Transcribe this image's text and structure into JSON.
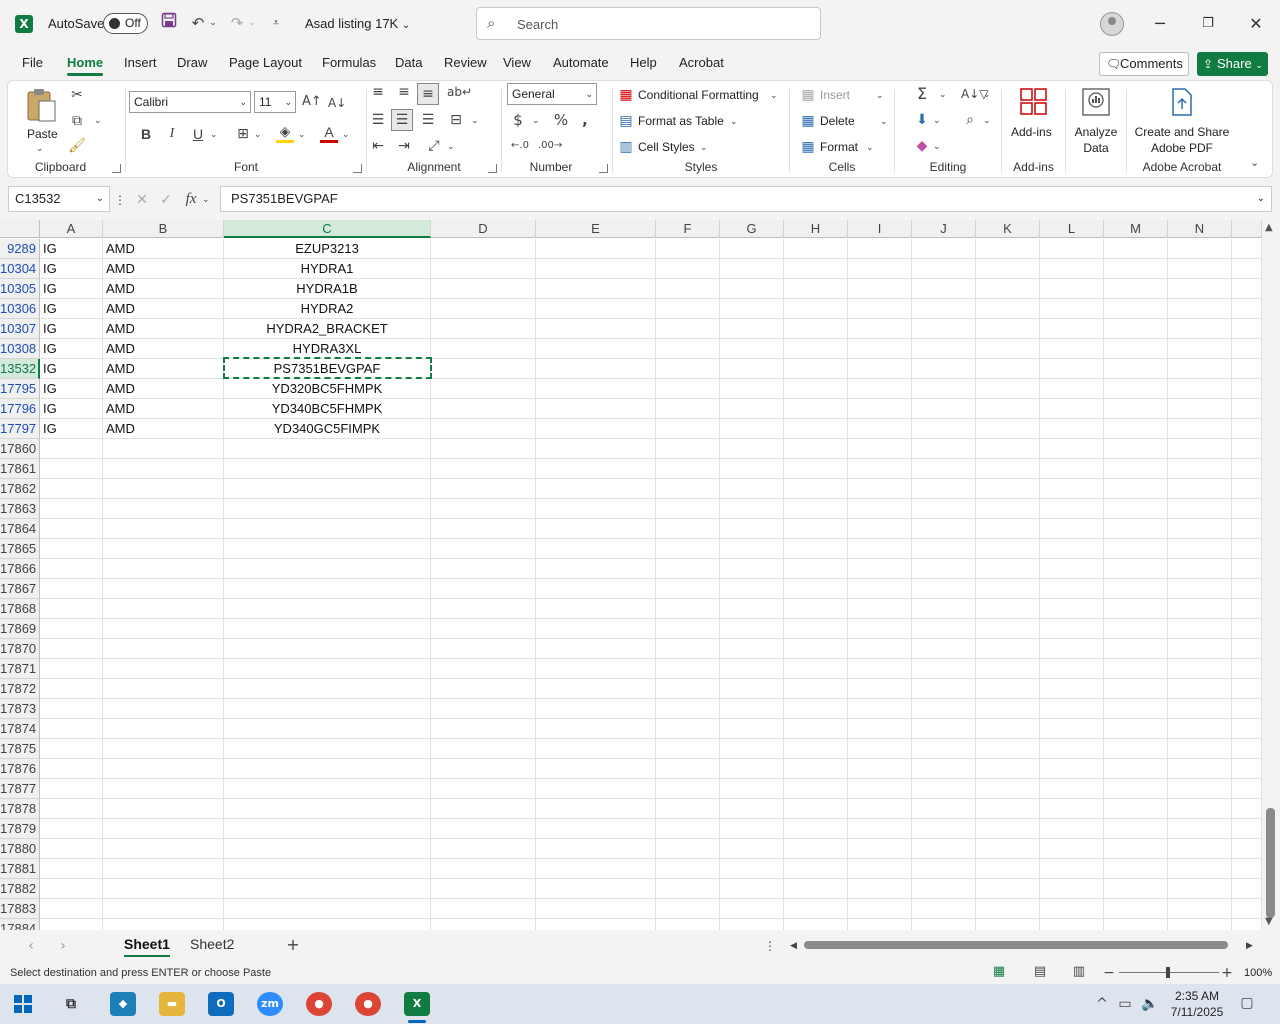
{
  "titlebar": {
    "autosave_label": "AutoSave",
    "autosave_state": "Off",
    "doc_title": "Asad listing 17K",
    "search_placeholder": "Search"
  },
  "menu": {
    "tabs": [
      "File",
      "Home",
      "Insert",
      "Draw",
      "Page Layout",
      "Formulas",
      "Data",
      "Review",
      "View",
      "Automate",
      "Help",
      "Acrobat"
    ],
    "active": "Home",
    "comments_label": "Comments",
    "share_label": "Share"
  },
  "ribbon": {
    "clipboard": {
      "paste_label": "Paste",
      "group_label": "Clipboard"
    },
    "font": {
      "font_name": "Calibri",
      "font_size": "11",
      "group_label": "Font",
      "bold": "B",
      "italic": "I",
      "underline": "U"
    },
    "alignment": {
      "group_label": "Alignment"
    },
    "number": {
      "format": "General",
      "group_label": "Number"
    },
    "styles": {
      "conditional": "Conditional Formatting",
      "format_table": "Format as Table",
      "cell_styles": "Cell Styles",
      "group_label": "Styles"
    },
    "cells": {
      "insert": "Insert",
      "delete": "Delete",
      "format": "Format",
      "group_label": "Cells"
    },
    "editing": {
      "group_label": "Editing"
    },
    "addins": {
      "label": "Add-ins",
      "group_label": "Add-ins"
    },
    "analyze": {
      "label_line1": "Analyze",
      "label_line2": "Data"
    },
    "acrobat": {
      "label_line1": "Create and Share",
      "label_line2": "Adobe PDF",
      "group_label": "Adobe Acrobat"
    }
  },
  "formula_bar": {
    "name_box": "C13532",
    "formula": "PS7351BEVGPAF"
  },
  "grid": {
    "columns": [
      "A",
      "B",
      "C",
      "D",
      "E",
      "F",
      "G",
      "H",
      "I",
      "J",
      "K",
      "L",
      "M",
      "N"
    ],
    "selected_column": "C",
    "data_rows": [
      {
        "row": "9289",
        "a": "IG",
        "b": "AMD",
        "c": "EZUP3213"
      },
      {
        "row": "10304",
        "a": "IG",
        "b": "AMD",
        "c": "HYDRA1"
      },
      {
        "row": "10305",
        "a": "IG",
        "b": "AMD",
        "c": "HYDRA1B"
      },
      {
        "row": "10306",
        "a": "IG",
        "b": "AMD",
        "c": "HYDRA2"
      },
      {
        "row": "10307",
        "a": "IG",
        "b": "AMD",
        "c": "HYDRA2_BRACKET"
      },
      {
        "row": "10308",
        "a": "IG",
        "b": "AMD",
        "c": "HYDRA3XL"
      },
      {
        "row": "13532",
        "a": "IG",
        "b": "AMD",
        "c": "PS7351BEVGPAF"
      },
      {
        "row": "17795",
        "a": "IG",
        "b": "AMD",
        "c": "YD320BC5FHMPK"
      },
      {
        "row": "17796",
        "a": "IG",
        "b": "AMD",
        "c": "YD340BC5FHMPK"
      },
      {
        "row": "17797",
        "a": "IG",
        "b": "AMD",
        "c": "YD340GC5FIMPK"
      }
    ],
    "selected_row": "13532",
    "empty_rows": [
      "17860",
      "17861",
      "17862",
      "17863",
      "17864",
      "17865",
      "17866",
      "17867",
      "17868",
      "17869",
      "17870",
      "17871",
      "17872",
      "17873",
      "17874",
      "17875",
      "17876",
      "17877",
      "17878",
      "17879",
      "17880",
      "17881",
      "17882",
      "17883",
      "17884"
    ]
  },
  "sheets": {
    "tabs": [
      "Sheet1",
      "Sheet2"
    ],
    "active": "Sheet1"
  },
  "statusbar": {
    "message": "Select destination and press ENTER or choose Paste",
    "zoom": "100%"
  },
  "taskbar": {
    "time": "2:35 AM",
    "date": "7/11/2025"
  },
  "colors": {
    "excel_green": "#107c41",
    "filtered_row_blue": "#1f4fb4"
  }
}
